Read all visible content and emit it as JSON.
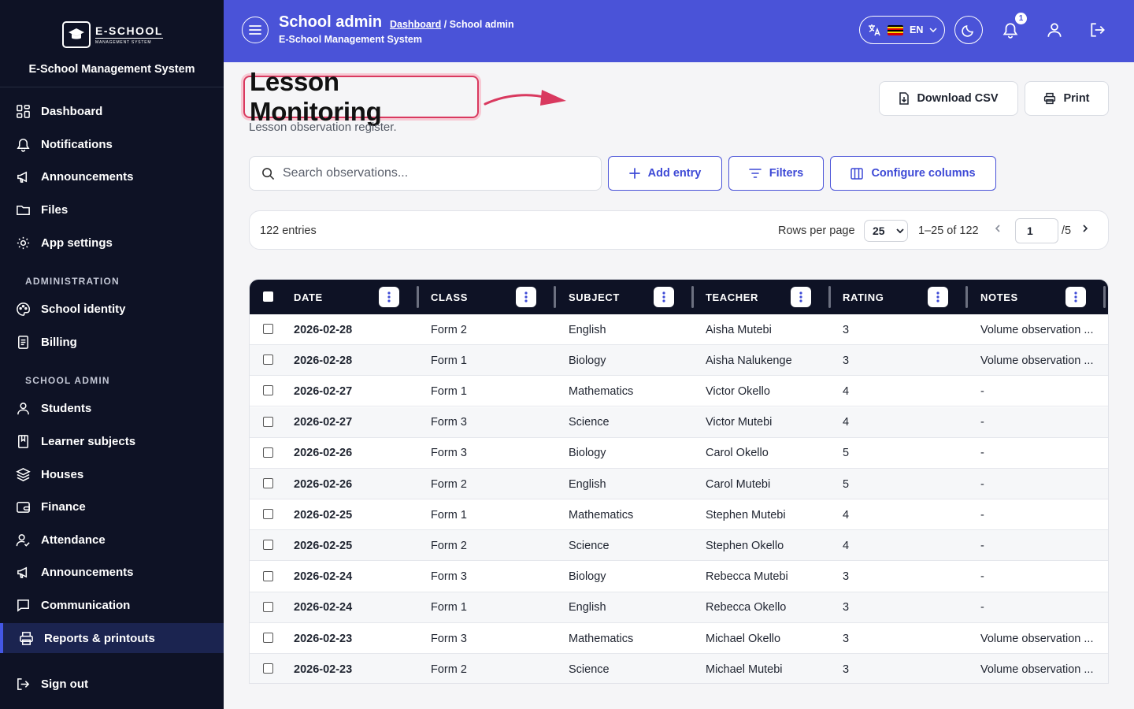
{
  "sidebar": {
    "logo_main": "E-SCHOOL",
    "logo_sub": "MANAGEMENT SYSTEM",
    "system_name": "E-School Management System",
    "general": [
      {
        "label": "Dashboard",
        "icon": "dashboard-icon"
      },
      {
        "label": "Notifications",
        "icon": "bell-icon"
      },
      {
        "label": "Announcements",
        "icon": "megaphone-icon"
      },
      {
        "label": "Files",
        "icon": "folder-icon"
      },
      {
        "label": "App settings",
        "icon": "gear-icon"
      }
    ],
    "admin_heading": "ADMINISTRATION",
    "admin": [
      {
        "label": "School identity",
        "icon": "palette-icon"
      },
      {
        "label": "Billing",
        "icon": "invoice-icon"
      }
    ],
    "school_heading": "SCHOOL ADMIN",
    "school": [
      {
        "label": "Students",
        "icon": "user-icon"
      },
      {
        "label": "Learner subjects",
        "icon": "book-icon"
      },
      {
        "label": "Houses",
        "icon": "layers-icon"
      },
      {
        "label": "Finance",
        "icon": "wallet-icon"
      },
      {
        "label": "Attendance",
        "icon": "user-check-icon"
      },
      {
        "label": "Announcements",
        "icon": "megaphone-icon"
      },
      {
        "label": "Communication",
        "icon": "message-icon"
      },
      {
        "label": "Reports & printouts",
        "icon": "printer-icon"
      }
    ],
    "sign_out": "Sign out"
  },
  "header": {
    "title": "School admin",
    "breadcrumb_link": "Dashboard",
    "breadcrumb_sep": " / ",
    "breadcrumb_current": "School admin",
    "subtitle": "E-School Management System",
    "language": "EN",
    "notification_count": "1"
  },
  "page": {
    "title": "Lesson Monitoring",
    "subtitle": "Lesson observation register.",
    "download_csv": "Download CSV",
    "print": "Print",
    "search_placeholder": "Search observations...",
    "add_entry": "Add entry",
    "filters": "Filters",
    "configure_columns": "Configure columns"
  },
  "pager": {
    "entries": "122 entries",
    "rows_per_page_label": "Rows per page",
    "rows_per_page": "25",
    "range": "1–25 of 122",
    "page": "1",
    "total_pages": "/5"
  },
  "table": {
    "columns": [
      "DATE",
      "CLASS",
      "SUBJECT",
      "TEACHER",
      "RATING",
      "NOTES"
    ],
    "rows": [
      [
        "2026-02-28",
        "Form 2",
        "English",
        "Aisha Mutebi",
        "3",
        "Volume observation ..."
      ],
      [
        "2026-02-28",
        "Form 1",
        "Biology",
        "Aisha Nalukenge",
        "3",
        "Volume observation ..."
      ],
      [
        "2026-02-27",
        "Form 1",
        "Mathematics",
        "Victor Okello",
        "4",
        "-"
      ],
      [
        "2026-02-27",
        "Form 3",
        "Science",
        "Victor Mutebi",
        "4",
        "-"
      ],
      [
        "2026-02-26",
        "Form 3",
        "Biology",
        "Carol Okello",
        "5",
        "-"
      ],
      [
        "2026-02-26",
        "Form 2",
        "English",
        "Carol Mutebi",
        "5",
        "-"
      ],
      [
        "2026-02-25",
        "Form 1",
        "Mathematics",
        "Stephen Mutebi",
        "4",
        "-"
      ],
      [
        "2026-02-25",
        "Form 2",
        "Science",
        "Stephen Okello",
        "4",
        "-"
      ],
      [
        "2026-02-24",
        "Form 3",
        "Biology",
        "Rebecca Mutebi",
        "3",
        "-"
      ],
      [
        "2026-02-24",
        "Form 1",
        "English",
        "Rebecca Okello",
        "3",
        "-"
      ],
      [
        "2026-02-23",
        "Form 3",
        "Mathematics",
        "Michael Okello",
        "3",
        "Volume observation ..."
      ],
      [
        "2026-02-23",
        "Form 2",
        "Science",
        "Michael Mutebi",
        "3",
        "Volume observation ..."
      ]
    ]
  },
  "colors": {
    "sidebar_bg": "#0e1225",
    "header_bg": "#4a53d8",
    "accent": "#3d49d6",
    "highlight": "#d9395f"
  }
}
